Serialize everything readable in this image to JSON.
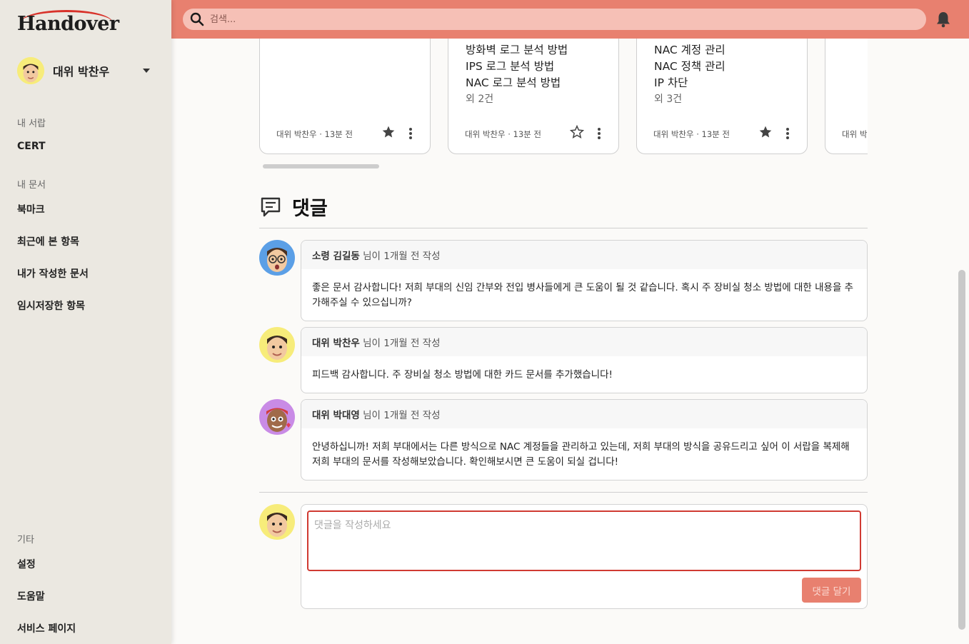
{
  "app": {
    "logo": "Handover"
  },
  "user": {
    "name": "대위 박찬우"
  },
  "sidebar": {
    "sections": [
      {
        "title": "내 서랍",
        "items": [
          "CERT"
        ]
      },
      {
        "title": "내 문서",
        "items": [
          "북마크",
          "최근에 본 항목",
          "내가 작성한 문서",
          "임시저장한 항목"
        ]
      },
      {
        "title": "기타",
        "items": [
          "설정",
          "도움말",
          "서비스 페이지"
        ]
      }
    ]
  },
  "search": {
    "placeholder": "검색..."
  },
  "cards": [
    {
      "lines": [],
      "more": "",
      "meta": "대위 박찬우 · 13분 전",
      "starred": true
    },
    {
      "lines": [
        "방화벽 로그 분석 방법",
        "IPS 로그 분석 방법",
        "NAC 로그 분석 방법"
      ],
      "more": "외 2건",
      "meta": "대위 박찬우 · 13분 전",
      "starred": false
    },
    {
      "lines": [
        "NAC 계정 관리",
        "NAC 정책 관리",
        "IP 차단"
      ],
      "more": "외 3건",
      "meta": "대위 박찬우 · 13분 전",
      "starred": true
    },
    {
      "lines": [],
      "more": "",
      "meta": "대위 박",
      "starred": false
    }
  ],
  "comments": {
    "title": "댓글",
    "items": [
      {
        "author": "소령 김길동",
        "suffix": " 님이 1개월 전 작성",
        "body": "좋은 문서 감사합니다! 저희 부대의 신임 간부와 전입 병사들에게 큰 도움이 될 것 같습니다. 혹시 주 장비실 청소 방법에 대한 내용을 추가해주실 수 있으십니까?"
      },
      {
        "author": "대위 박찬우",
        "suffix": " 님이 1개월 전 작성",
        "body": "피드백 감사합니다. 주 장비실 청소 방법에 대한 카드 문서를 추가했습니다!"
      },
      {
        "author": "대위 박대영",
        "suffix": " 님이 1개월 전 작성",
        "body": "안녕하십니까! 저희 부대에서는 다른 방식으로 NAC 계정들을 관리하고 있는데, 저희 부대의 방식을 공유드리고 싶어 이 서랍을 복제해 저희 부대의 문서를 작성해보았습니다. 확인해보시면 큰 도움이 되실 겁니다!"
      }
    ],
    "compose_placeholder": "댓글을 작성하세요",
    "submit_label": "댓글 달기"
  },
  "colors": {
    "accent": "#e8806f",
    "sidebar": "#ebe8e1",
    "focus_border": "#d03a32"
  }
}
